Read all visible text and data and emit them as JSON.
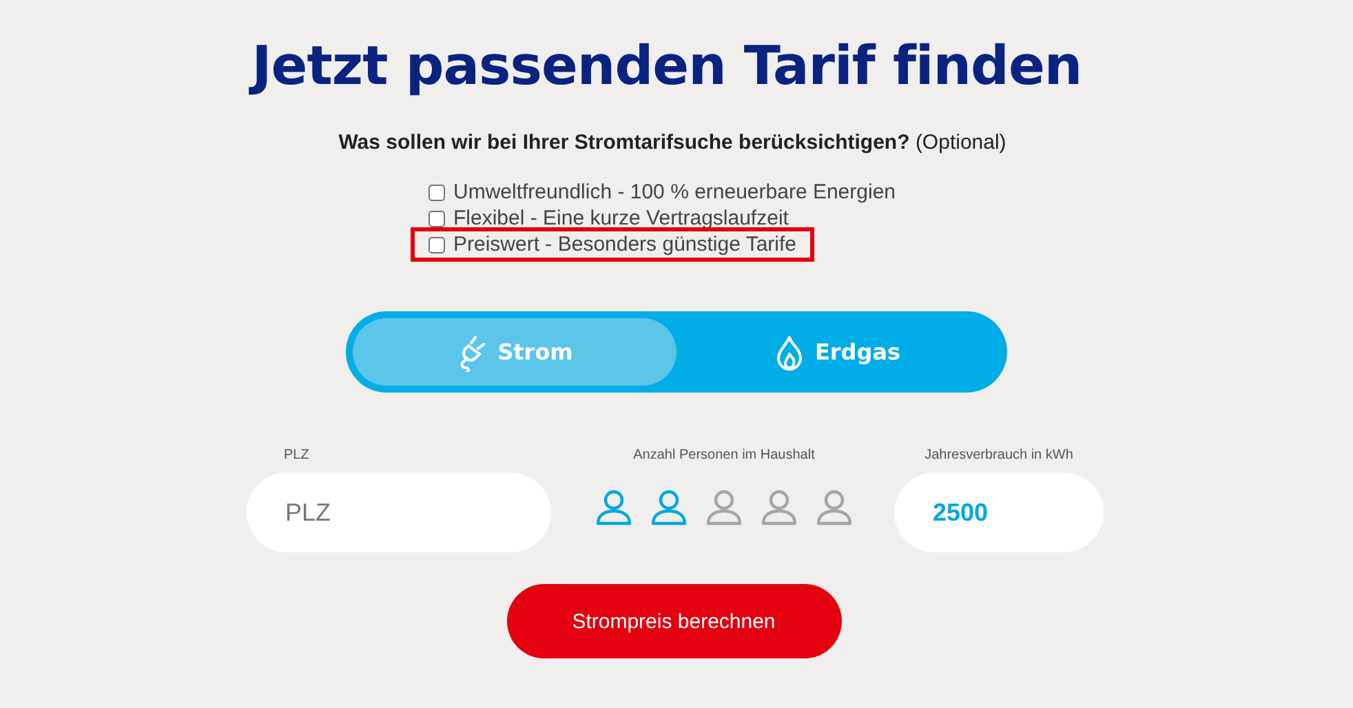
{
  "title": "Jetzt passenden Tarif finden",
  "question": {
    "text": "Was sollen wir bei Ihrer Stromtarifsuche berücksichtigen?",
    "note": "(Optional)"
  },
  "options": [
    {
      "label": "Umweltfreundlich - 100 % erneuerbare Energien",
      "checked": false,
      "highlighted": false
    },
    {
      "label": "Flexibel - Eine kurze Vertragslaufzeit",
      "checked": false,
      "highlighted": false
    },
    {
      "label": "Preiswert - Besonders günstige Tarife",
      "checked": false,
      "highlighted": true
    }
  ],
  "energy_tabs": [
    {
      "kind": "plug",
      "label": "Strom",
      "selected": true
    },
    {
      "kind": "flame",
      "label": "Erdgas",
      "selected": false
    }
  ],
  "postcode": {
    "label": "PLZ",
    "placeholder": "PLZ"
  },
  "persons": {
    "label": "Anzahl Personen im Haushalt",
    "items": [
      {
        "selected": true
      },
      {
        "selected": true
      },
      {
        "selected": false
      },
      {
        "selected": false
      },
      {
        "selected": false
      }
    ]
  },
  "consumption": {
    "label": "Jahresverbrauch in kWh",
    "value": "2500"
  },
  "submit": "Strompreis berechnen"
}
